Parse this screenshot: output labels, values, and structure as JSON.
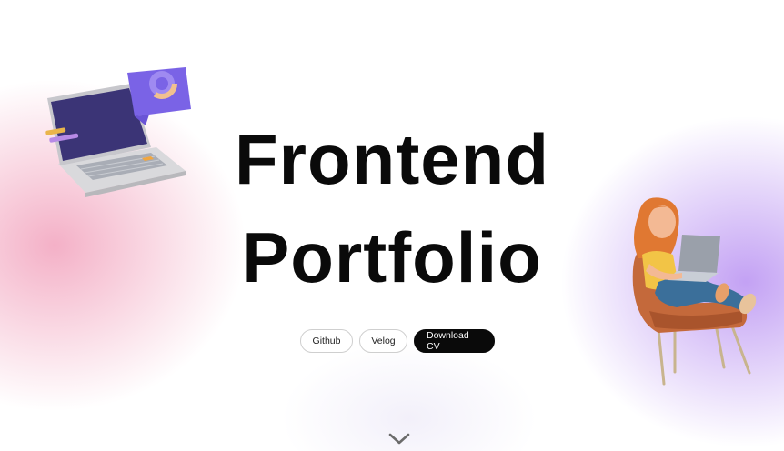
{
  "hero": {
    "title_line1": "Frontend",
    "title_line2": "Portfolio"
  },
  "buttons": {
    "github": "Github",
    "velog": "Velog",
    "download_cv": "Download CV"
  },
  "icons": {
    "scroll_down": "chevron-down-icon",
    "left_illustration": "laptop-chart-illustration",
    "right_illustration": "girl-with-laptop-in-chair-illustration"
  },
  "colors": {
    "pink_glow": "#f096b4",
    "purple_glow": "#af82f0",
    "primary_button": "#0a0a0a",
    "text": "#0a0a0a"
  }
}
